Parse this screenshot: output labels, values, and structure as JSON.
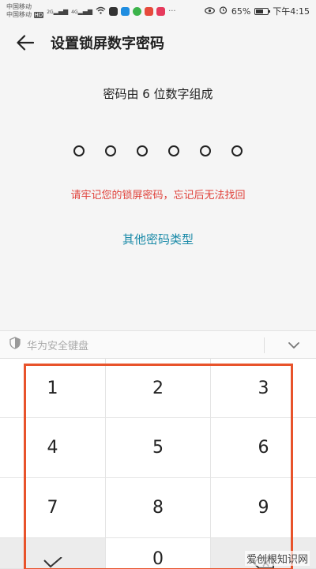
{
  "status_bar": {
    "carrier1": "中国移动",
    "carrier2": "中国移动",
    "hd_badge": "HD",
    "net1": "2G",
    "net2": "4G",
    "battery_text": "65%",
    "time": "下午4:15",
    "battery_level": 0.65
  },
  "header": {
    "title": "设置锁屏数字密码"
  },
  "content": {
    "instruction": "密码由 6 位数字组成",
    "pin_length": 6,
    "warning": "请牢记您的锁屏密码，忘记后无法找回",
    "other_types": "其他密码类型"
  },
  "keyboard": {
    "title": "华为安全键盘",
    "keys": [
      "1",
      "2",
      "3",
      "4",
      "5",
      "6",
      "7",
      "8",
      "9",
      "0"
    ]
  },
  "watermark": "爱创根知识网",
  "colors": {
    "warning": "#e0413a",
    "link": "#1a8aa8",
    "highlight": "#e8532b"
  },
  "icons": {
    "back": "arrow-left-icon",
    "shield": "shield-icon",
    "collapse": "chevron-down-icon",
    "confirm": "check-icon",
    "delete": "backspace-icon"
  }
}
